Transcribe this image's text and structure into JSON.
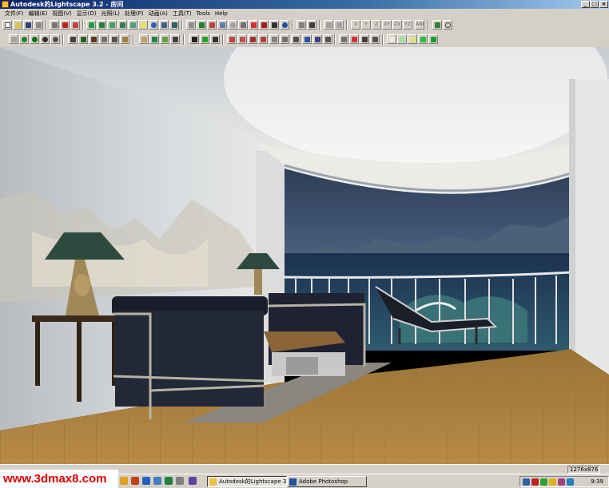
{
  "window": {
    "title": "Autodesk的Lightscape 3.2 - 房间",
    "controls": [
      "_",
      "□",
      "×"
    ]
  },
  "menu": [
    "文件(F)",
    "编辑(E)",
    "视图(V)",
    "显示(D)",
    "光照(L)",
    "处理(P)",
    "动画(A)",
    "工具(T)",
    "Tools",
    "Help"
  ],
  "toolbar1_axis": [
    "X",
    "Y",
    "Z",
    "XY",
    "ZX",
    "YZ",
    "ANI"
  ],
  "status": {
    "coords": "1276x876"
  },
  "taskbar": {
    "watermark": "www.3dmax8.com",
    "tasks": [
      {
        "label": "Autodesk的Lightscape 3....",
        "active": true
      },
      {
        "label": "Adobe Photoshop",
        "active": false
      }
    ],
    "clock": "9:39"
  },
  "colors": {
    "title_bar": "#0a246a",
    "window_bg": "#d4d0c8",
    "watermark_text": "#dd0000"
  }
}
